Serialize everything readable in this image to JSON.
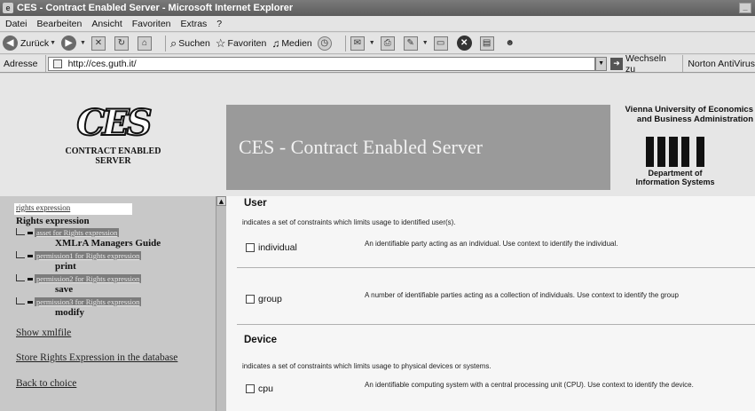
{
  "window": {
    "title": "CES - Contract Enabled Server - Microsoft Internet Explorer"
  },
  "menu": [
    "Datei",
    "Bearbeiten",
    "Ansicht",
    "Favoriten",
    "Extras",
    "?"
  ],
  "toolbar": {
    "back": "Zurück",
    "search": "Suchen",
    "favorites": "Favoriten",
    "media": "Medien"
  },
  "address": {
    "label": "Adresse",
    "url": "http://ces.guth.it/",
    "go": "Wechseln zu",
    "norton": "Norton AntiVirus"
  },
  "banner": {
    "logo_letters": "CES",
    "logo_line1": "CONTRACT ENABLED",
    "logo_line2": "SERVER",
    "title": "CES - Contract Enabled Server",
    "university_line1": "Vienna University of Economics",
    "university_line2": "and Business Administration",
    "wi_text": "WI",
    "dept_line1": "Department of",
    "dept_line2": "Information Systems"
  },
  "sidebar": {
    "search_link": "rights expression",
    "heading": "Rights expression",
    "items": [
      {
        "link": "asset for Rights expression",
        "name": "XMLrA Managers Guide"
      },
      {
        "link": "permission1 for Rights expression",
        "name": "print"
      },
      {
        "link": "permission2 for Rights expression",
        "name": "save"
      },
      {
        "link": "permission3 for Rights expression",
        "name": "modify"
      }
    ],
    "show_xml": "Show xmlfile",
    "store": "Store Rights Expression in the database",
    "back": "Back to choice"
  },
  "main": {
    "user": {
      "heading": "User",
      "description": "indicates a set of constraints which limits usage to identified user(s).",
      "options": [
        {
          "label": "individual",
          "description": "An identifiable party acting as an individual. Use context to identify the individual."
        },
        {
          "label": "group",
          "description": "A number of identifiable parties acting as a collection of individuals. Use context to identify the group"
        }
      ]
    },
    "device": {
      "heading": "Device",
      "description": "indicates a set of constraints which limits usage to physical devices or systems.",
      "options": [
        {
          "label": "cpu",
          "description": "An identifiable computing system with a central processing unit (CPU). Use context to identify the device."
        }
      ]
    }
  }
}
